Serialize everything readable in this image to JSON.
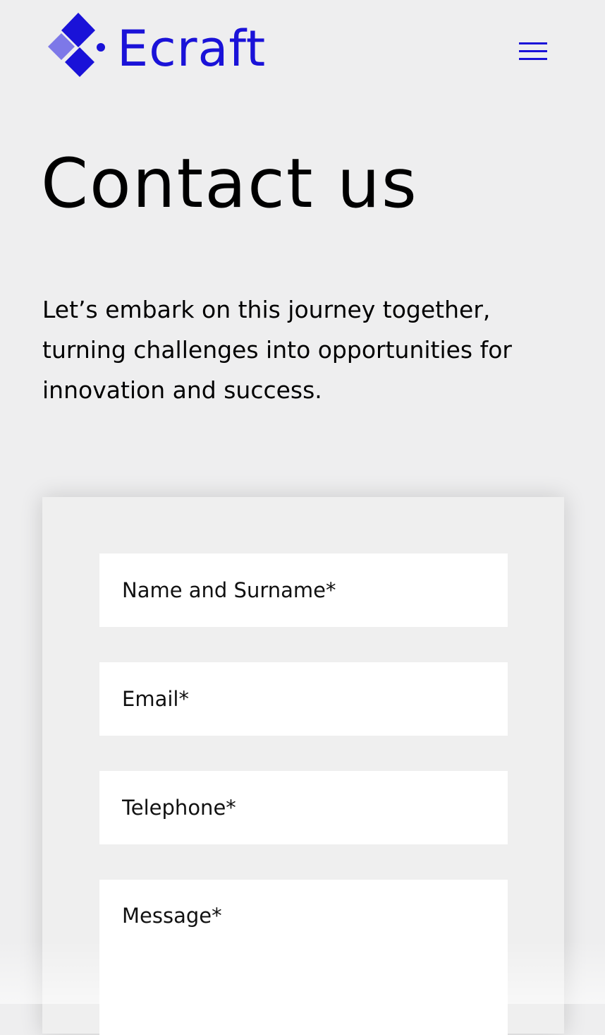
{
  "brand": {
    "name": "Ecraft",
    "color": "#1a12d8",
    "accent_light": "#7d78e8",
    "logo_icon": "diamond-logo-icon"
  },
  "header": {
    "menu_icon": "hamburger-menu-icon"
  },
  "page": {
    "title": "Contact us",
    "intro": "Let’s embark on this journey together, turning challenges into opportunities for innovation and success."
  },
  "form": {
    "name_placeholder": "Name and Surname*",
    "email_placeholder": "Email*",
    "telephone_placeholder": "Telephone*",
    "message_placeholder": "Message*"
  }
}
